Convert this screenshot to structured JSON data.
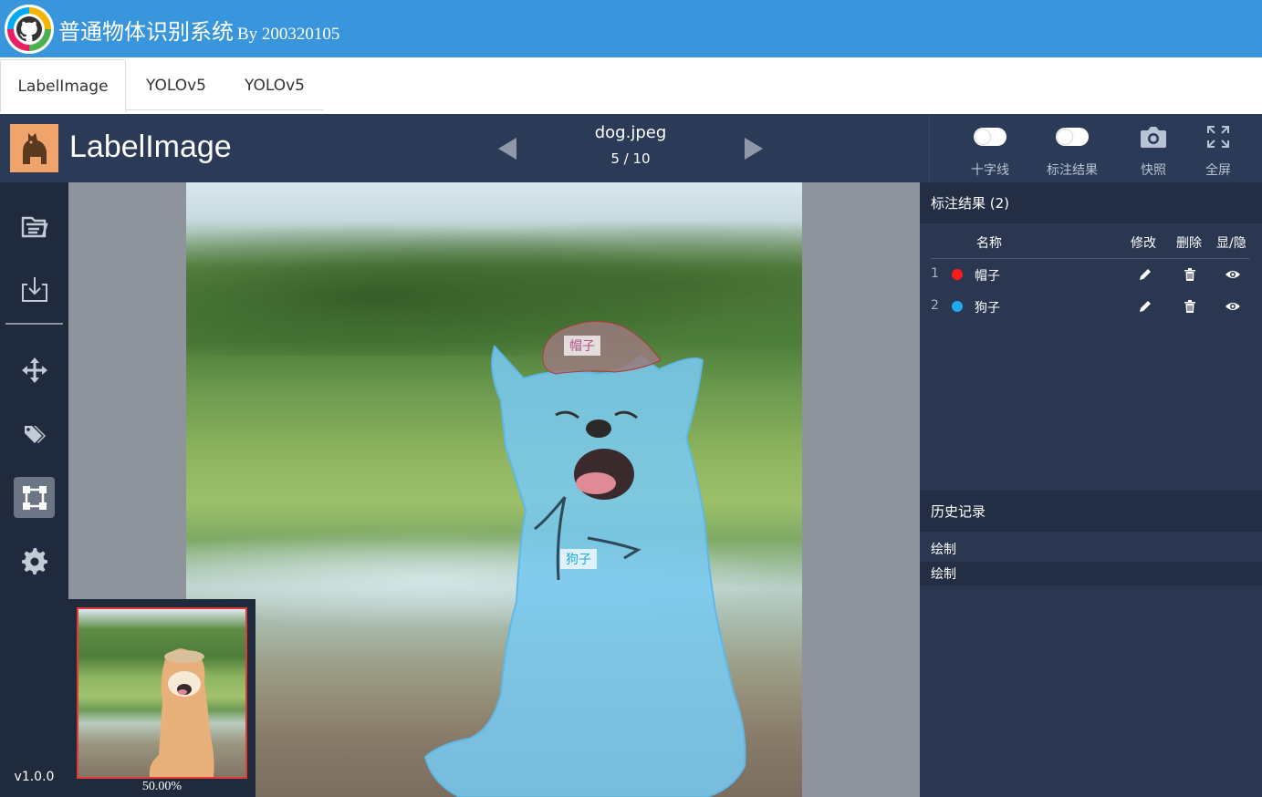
{
  "header": {
    "title": "普通物体识别系统",
    "subtitle": "By 200320105"
  },
  "tabs": [
    {
      "label": "LabelImage",
      "active": true
    },
    {
      "label": "YOLOv5",
      "active": false
    },
    {
      "label": "YOLOv5",
      "active": false
    }
  ],
  "editor": {
    "app_name": "LabelImage",
    "file_name": "dog.jpeg",
    "file_index": "5 / 10",
    "tools": {
      "crosshair": "十字线",
      "show_results": "标注结果",
      "snapshot": "快照",
      "fullscreen": "全屏"
    }
  },
  "sidebar": {
    "version": "v1.0.0"
  },
  "canvas": {
    "labels": {
      "hat": "帽子",
      "dog": "狗子"
    },
    "minimap_zoom": "50.00%"
  },
  "annotations_panel": {
    "title": "标注结果 (2)",
    "columns": {
      "name": "名称",
      "edit": "修改",
      "delete": "删除",
      "toggle": "显/隐"
    },
    "items": [
      {
        "index": "1",
        "name": "帽子",
        "color": "#ff1a1a"
      },
      {
        "index": "2",
        "name": "狗子",
        "color": "#20a8ef"
      }
    ]
  },
  "history_panel": {
    "title": "历史记录",
    "items": [
      "绘制",
      "绘制"
    ]
  },
  "colors": {
    "header_blue": "#3996dc",
    "toolbar_navy": "#2a3a57",
    "sidebar_dark": "#1f2a3d",
    "panel_bg": "#2b3750",
    "hat_color": "#ff1a1a",
    "dog_color": "#20a8ef"
  }
}
